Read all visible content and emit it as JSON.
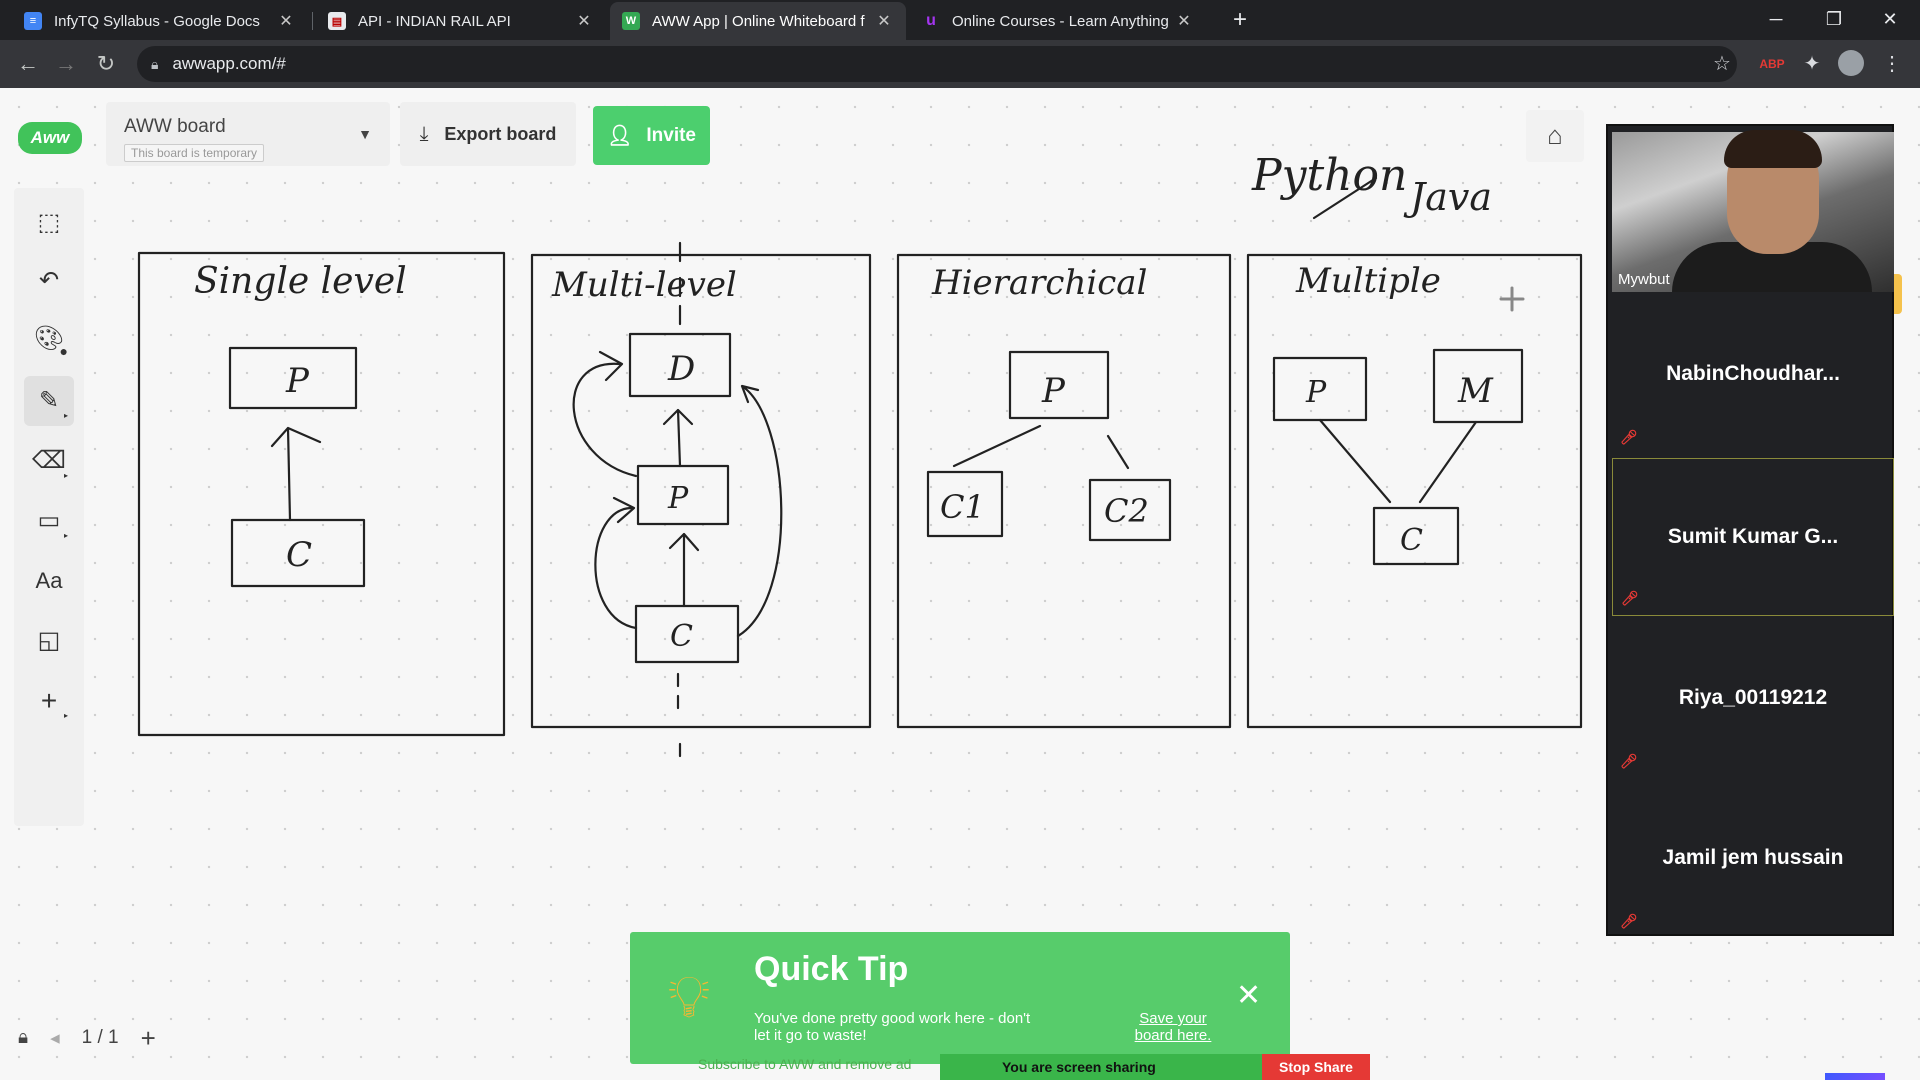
{
  "browser": {
    "tabs": [
      {
        "title": "InfyTQ Syllabus - Google Docs",
        "fav": "≡",
        "fav_color": "#4285f4",
        "active": false
      },
      {
        "title": "API - INDIAN RAIL API",
        "fav": "▤",
        "fav_color": "#e8eaed",
        "active": false
      },
      {
        "title": "AWW App | Online Whiteboard f",
        "fav": "W",
        "fav_color": "#34a853",
        "active": true
      },
      {
        "title": "Online Courses - Learn Anything",
        "fav": "u",
        "fav_color": "#a435f0",
        "active": false
      }
    ],
    "url": "awwapp.com/#"
  },
  "app": {
    "logo": "Aww",
    "board_name": "AWW board",
    "board_status": "This board is temporary",
    "export_label": "Export board",
    "invite_label": "Invite",
    "page_indicator": "1 / 1"
  },
  "quick_tip": {
    "title": "Quick Tip",
    "message": "You've done pretty good work here - don't let it go to waste!",
    "link": "Save your board here."
  },
  "share_bar": {
    "text": "You are screen sharing",
    "stop_label": "Stop Share",
    "under_text": "Subscribe to AWW and remove ad"
  },
  "participants": {
    "video_name": "Mywbut",
    "names": [
      "NabinChoudhar...",
      "Sumit Kumar G...",
      "Riya_00119212",
      "Jamil jem hussain"
    ]
  },
  "whiteboard": {
    "top_notes": [
      "Python",
      "Java"
    ],
    "panels": [
      {
        "title": "Single level",
        "boxes": [
          "P",
          "C"
        ]
      },
      {
        "title": "Multi-level",
        "boxes": [
          "D",
          "P",
          "C"
        ]
      },
      {
        "title": "Hierarchical",
        "boxes": [
          "P",
          "C1",
          "C2"
        ]
      },
      {
        "title": "Multiple",
        "boxes": [
          "P",
          "M",
          "C"
        ]
      }
    ]
  },
  "colors": {
    "accent_green": "#4ccf6e",
    "tip_green": "#57cc6b",
    "stop_red": "#e53935"
  }
}
